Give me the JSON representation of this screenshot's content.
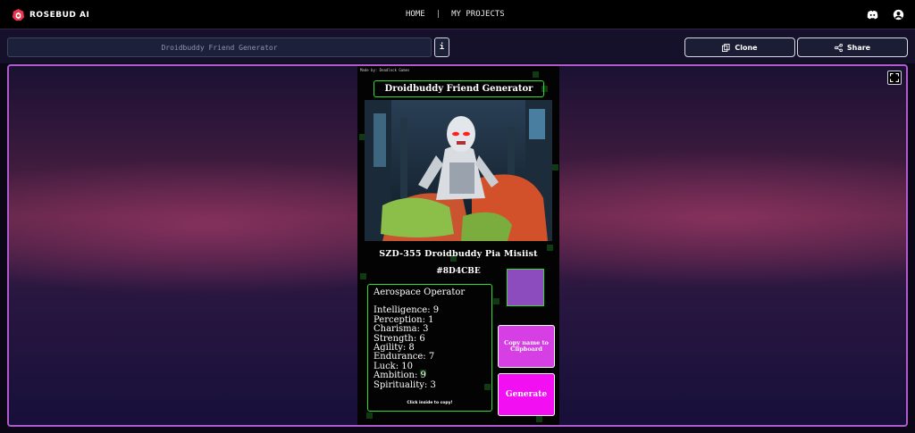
{
  "brand": {
    "name": "ROSEBUD AI",
    "logo_icon": "rosebud-logo-icon",
    "accent": "#e8344e"
  },
  "nav": {
    "home": "HOME",
    "separator": "|",
    "projects": "MY PROJECTS"
  },
  "top_icons": [
    "discord-icon",
    "account-icon"
  ],
  "toolbar": {
    "project_title": "Droidbuddy Friend Generator",
    "info_label": "i",
    "clone_label": "Clone",
    "share_label": "Share"
  },
  "game": {
    "made_by": "Made by: Deadlock Games",
    "title": "Droidbuddy Friend Generator",
    "portrait": "robot-portrait-image",
    "bot_name": "SZD-355 Droidbuddy Pia Misiist",
    "color_hex": "#8D4CBE",
    "swatch_color": "#8d4cbe",
    "role": "Aerospace Operator",
    "stats": [
      {
        "label": "Intelligence",
        "value": "9"
      },
      {
        "label": "Perception",
        "value": "1"
      },
      {
        "label": "Charisma",
        "value": "3"
      },
      {
        "label": "Strength",
        "value": "6"
      },
      {
        "label": "Agility",
        "value": "8"
      },
      {
        "label": "Endurance",
        "value": "7"
      },
      {
        "label": "Luck",
        "value": "10"
      },
      {
        "label": "Ambition",
        "value": "9"
      },
      {
        "label": "Spirituality",
        "value": "3"
      }
    ],
    "copy_hint": "Click inside to copy!",
    "copy_button": "Copy name to Clipboard",
    "generate_button": "Generate",
    "border_color": "#2ee02e",
    "button_color": "#f20ff2"
  }
}
